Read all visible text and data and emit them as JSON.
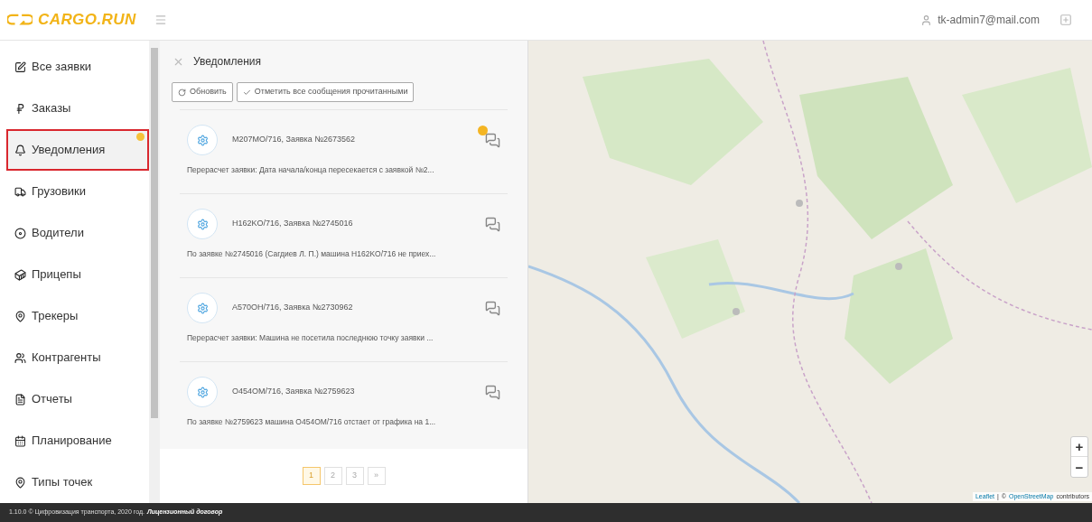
{
  "header": {
    "logo": "CARGO.RUN",
    "user": "tk-admin7@mail.com"
  },
  "sidebar": {
    "items": [
      {
        "label": "Все заявки",
        "selected": false,
        "badge": false
      },
      {
        "label": "Заказы",
        "selected": false,
        "badge": false
      },
      {
        "label": "Уведомления",
        "selected": true,
        "badge": true
      },
      {
        "label": "Грузовики",
        "selected": false,
        "badge": false
      },
      {
        "label": "Водители",
        "selected": false,
        "badge": false
      },
      {
        "label": "Прицепы",
        "selected": false,
        "badge": false
      },
      {
        "label": "Трекеры",
        "selected": false,
        "badge": false
      },
      {
        "label": "Контрагенты",
        "selected": false,
        "badge": false
      },
      {
        "label": "Отчеты",
        "selected": false,
        "badge": false
      },
      {
        "label": "Планирование",
        "selected": false,
        "badge": false
      },
      {
        "label": "Типы точек",
        "selected": false,
        "badge": false
      }
    ]
  },
  "panel": {
    "title": "Уведомления",
    "buttons": [
      "Обновить",
      "Отметить все сообщения прочитанными"
    ],
    "notifications": [
      {
        "title": "M207MO/716, Заявка №2673562",
        "text": "Перерасчет заявки: Дата начала/конца пересекается с заявкой №2...",
        "unread": true
      },
      {
        "title": "H162KO/716, Заявка №2745016",
        "text": "По заявке №2745016 (Сагдиев Л. П.) машина H162KO/716 не приех...",
        "unread": false
      },
      {
        "title": "A570OH/716, Заявка №2730962",
        "text": "Перерасчет заявки: Машина не посетила последнюю точку заявки ...",
        "unread": false
      },
      {
        "title": "O454OM/716, Заявка №2759623",
        "text": "По заявке №2759623 машина O454OM/716 отстает от графика на 1...",
        "unread": false
      }
    ],
    "pages": [
      {
        "label": "1",
        "selected": true
      },
      {
        "label": "2",
        "selected": false
      },
      {
        "label": "3",
        "selected": false
      },
      {
        "label": "»",
        "selected": false
      }
    ]
  },
  "map": {
    "zoom_in": "+",
    "zoom_out": "−",
    "attribution": [
      "Leaflet",
      "|",
      "©",
      "OpenStreetMap",
      "contributors"
    ]
  },
  "footer": {
    "text": "1.10.0 © Цифровизация транспорта, 2020 год.",
    "link": "Лицензионный договор"
  }
}
